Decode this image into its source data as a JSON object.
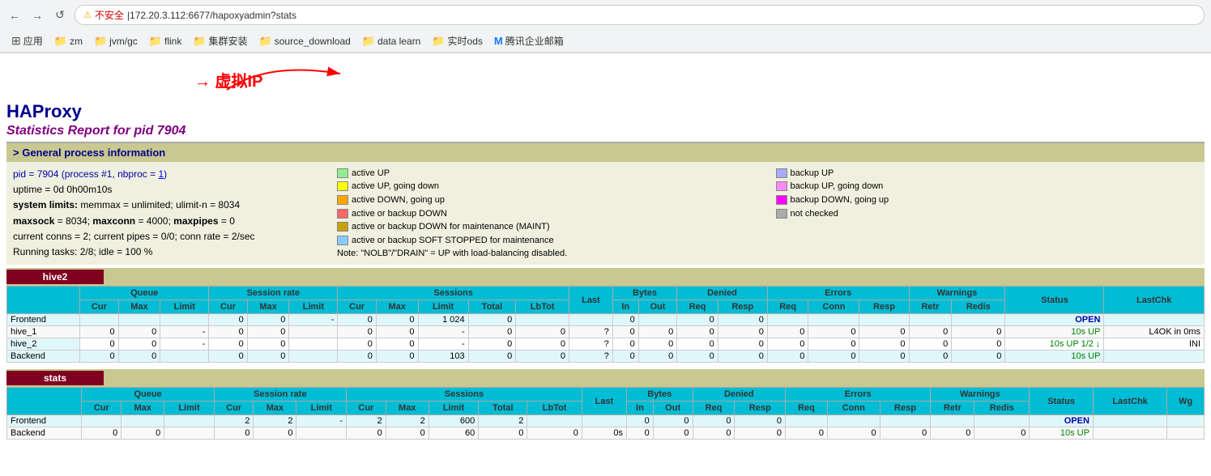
{
  "browser": {
    "nav_back": "←",
    "nav_forward": "→",
    "nav_refresh": "↺",
    "lock_label": "不安全",
    "address": "172.20.3.112:6677/hapoxyadmin?stats",
    "address_display": "172.20.3.112:6677/hapoxyadmin?stats",
    "bookmarks": [
      {
        "label": "应用",
        "type": "apps"
      },
      {
        "label": "zm",
        "type": "folder"
      },
      {
        "label": "jvm/gc",
        "type": "folder"
      },
      {
        "label": "flink",
        "type": "folder"
      },
      {
        "label": "集群安装",
        "type": "folder"
      },
      {
        "label": "source_download",
        "type": "folder"
      },
      {
        "label": "data learn",
        "type": "folder"
      },
      {
        "label": "实时ods",
        "type": "folder"
      },
      {
        "label": "腾讯企业邮箱",
        "type": "special"
      }
    ]
  },
  "annotation": {
    "arrow_label": "→ 虚拟IP"
  },
  "haproxy": {
    "title": "HAProxy",
    "stats_title": "Statistics Report for pid 7904",
    "section_general": "> General process information",
    "pid_line": "pid = 7904 (process #1, nbproc = 1)",
    "uptime": "uptime = 0d 0h00m10s",
    "system_limits": "system limits: memmax = unlimited; ulimit-n = 8034",
    "maxsock": "maxsock = 8034; maxconn = 4000; maxpipes = 0",
    "current_conns": "current conns = 2; current pipes = 0/0; conn rate = 2/sec",
    "running_tasks": "Running tasks: 2/8; idle = 100 %"
  },
  "legend": [
    {
      "color": "#90ee90",
      "label": "active UP"
    },
    {
      "color": "#aaaaff",
      "label": "backup UP"
    },
    {
      "color": "#ffff00",
      "label": "active UP, going down"
    },
    {
      "color": "#ff88ff",
      "label": "backup UP, going down"
    },
    {
      "color": "#ffa500",
      "label": "active DOWN, going up"
    },
    {
      "color": "#ff00ff",
      "label": "backup DOWN, going up"
    },
    {
      "color": "#ff6666",
      "label": "active or backup DOWN"
    },
    {
      "color": "#aaaaaa",
      "label": "not checked"
    },
    {
      "color": "#c8a000",
      "label": "active or backup DOWN for maintenance (MAINT)"
    },
    {
      "color": "#88ccff",
      "label": "active or backup SOFT STOPPED for maintenance"
    },
    {
      "color": "",
      "label": "Note: \"NOLB\"/\"DRAIN\" = UP with load-balancing disabled."
    }
  ],
  "hive2_table": {
    "service_name": "hive2",
    "col_groups": [
      "Queue",
      "Session rate",
      "Sessions",
      "Bytes",
      "Denied",
      "Errors",
      "Warnings"
    ],
    "col_headers": [
      "Cur",
      "Max",
      "Limit",
      "Cur",
      "Max",
      "Limit",
      "Cur",
      "Max",
      "Limit",
      "Total",
      "LbTot",
      "Last",
      "In",
      "Out",
      "Req",
      "Resp",
      "Req",
      "Conn",
      "Resp",
      "Retr",
      "Redis",
      "Status",
      "LastChk"
    ],
    "rows": [
      {
        "name": "Frontend",
        "cols": [
          "",
          "",
          "",
          "0",
          "0",
          "-",
          "0",
          "0",
          "1 024",
          "0",
          "",
          "",
          "0",
          "",
          "0",
          "0",
          "",
          "",
          "",
          "",
          "",
          "OPEN",
          ""
        ]
      },
      {
        "name": "hive_1",
        "cols": [
          "0",
          "0",
          "-",
          "0",
          "0",
          "",
          "0",
          "0",
          "-",
          "0",
          "0",
          "?",
          "0",
          "0",
          "0",
          "0",
          "0",
          "0",
          "0",
          "0",
          "0",
          "10s UP",
          "L4OK in 0ms"
        ]
      },
      {
        "name": "hive_2",
        "cols": [
          "0",
          "0",
          "-",
          "0",
          "0",
          "",
          "0",
          "0",
          "-",
          "0",
          "0",
          "?",
          "0",
          "0",
          "0",
          "0",
          "0",
          "0",
          "0",
          "0",
          "0",
          "10s UP 1/2 ↓",
          "INI"
        ]
      },
      {
        "name": "Backend",
        "cols": [
          "0",
          "0",
          "",
          "0",
          "0",
          "",
          "0",
          "0",
          "103",
          "0",
          "0",
          "?",
          "0",
          "0",
          "0",
          "0",
          "0",
          "0",
          "0",
          "0",
          "0",
          "10s UP",
          ""
        ]
      }
    ]
  },
  "stats_table": {
    "service_name": "stats",
    "col_groups": [
      "Queue",
      "Session rate",
      "Sessions",
      "Bytes",
      "Denied",
      "Errors",
      "Warnings"
    ],
    "col_headers": [
      "Cur",
      "Max",
      "Limit",
      "Cur",
      "Max",
      "Limit",
      "Cur",
      "Max",
      "Limit",
      "Total",
      "LbTot",
      "Last",
      "In",
      "Out",
      "Req",
      "Resp",
      "Req",
      "Conn",
      "Resp",
      "Retr",
      "Redis",
      "Status",
      "LastChk",
      "Wg"
    ],
    "rows": [
      {
        "name": "Frontend",
        "cols": [
          "",
          "",
          "",
          "2",
          "2",
          "-",
          "2",
          "2",
          "600",
          "2",
          "",
          "",
          "0",
          "0",
          "0",
          "0",
          "",
          "",
          "",
          "",
          "",
          "OPEN",
          "",
          ""
        ]
      },
      {
        "name": "Backend",
        "cols": [
          "0",
          "0",
          "",
          "0",
          "0",
          "",
          "0",
          "0",
          "60",
          "0",
          "0",
          "0s",
          "0",
          "0",
          "0",
          "0",
          "0",
          "0",
          "0",
          "0",
          "0",
          "10s UP",
          "",
          ""
        ]
      }
    ]
  }
}
